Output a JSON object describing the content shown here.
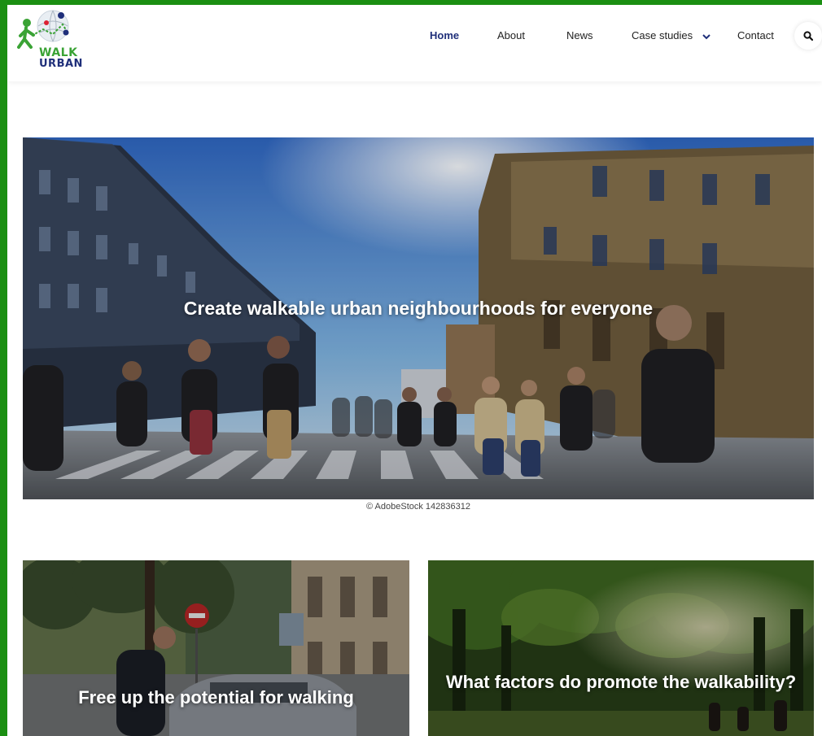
{
  "logo": {
    "line1": "WALK",
    "line2": "URBAN"
  },
  "nav": {
    "home": "Home",
    "about": "About",
    "news": "News",
    "case_studies": "Case studies",
    "contact": "Contact"
  },
  "hero": {
    "title": "Create walkable urban neighbourhoods for everyone",
    "caption": "© AdobeStock 142836312"
  },
  "cards": {
    "left_title": "Free up the potential for walking",
    "right_title": "What factors do promote the walkability?"
  },
  "colors": {
    "frame": "#1b8f12",
    "brand_green": "#3aa335",
    "brand_navy": "#1f2f7a"
  }
}
